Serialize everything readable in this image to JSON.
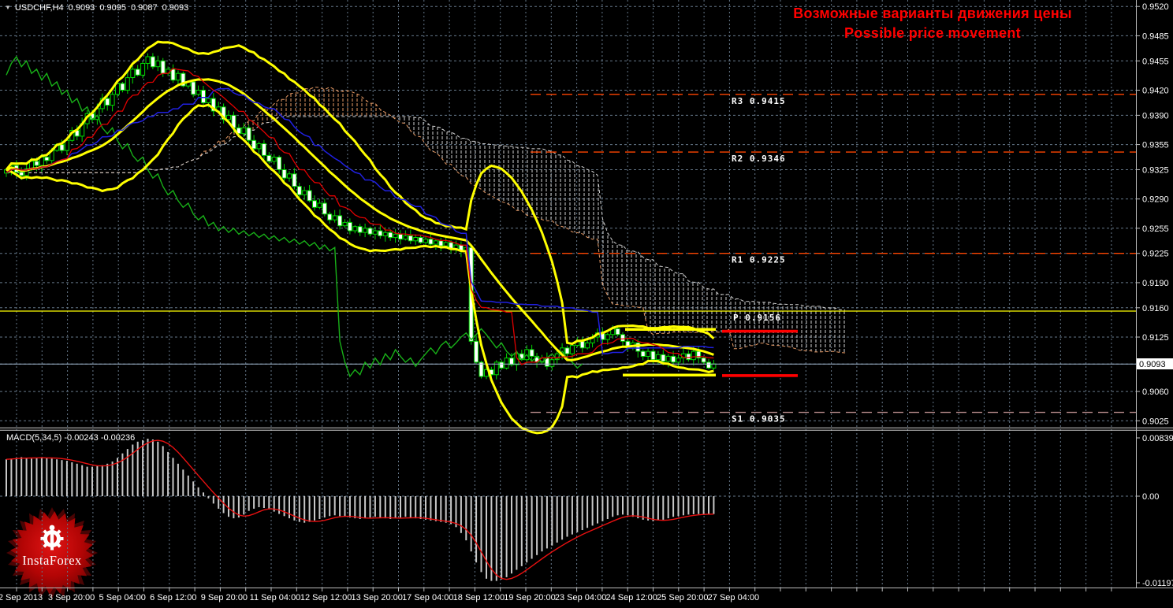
{
  "header": {
    "symbol_period": "USDCHF,H4",
    "open": "0.9093",
    "high": "0.9095",
    "low": "0.9087",
    "close": "0.9093"
  },
  "annotation": {
    "line1": "Возможные варианты движения цены",
    "line2": "Possible price movement",
    "color": "#FF0000"
  },
  "watermark": {
    "brand": "InstaForex"
  },
  "indicator_label": {
    "macd": "MACD(5,34,5) -0.00243 -0.00236"
  },
  "price_axis": {
    "ticks": [
      "0.9520",
      "0.9485",
      "0.9455",
      "0.9420",
      "0.9390",
      "0.9355",
      "0.9325",
      "0.9290",
      "0.9255",
      "0.9225",
      "0.9190",
      "0.9160",
      "0.9125",
      "0.9060",
      "0.9025"
    ],
    "current_price": "0.9093"
  },
  "macd_axis": {
    "ticks": [
      "0.00839",
      "0.00",
      "-0.01197"
    ]
  },
  "time_axis": {
    "labels": [
      "2 Sep 2013",
      "3 Sep 20:00",
      "5 Sep 04:00",
      "6 Sep 12:00",
      "9 Sep 20:00",
      "11 Sep 04:00",
      "12 Sep 12:00",
      "13 Sep 20:00",
      "17 Sep 04:00",
      "18 Sep 12:00",
      "19 Sep 20:00",
      "23 Sep 04:00",
      "24 Sep 12:00",
      "25 Sep 20:00",
      "27 Sep 04:00"
    ]
  },
  "levels": [
    {
      "name": "R3",
      "value": "0.9415",
      "style": "dashed",
      "role": "resistance"
    },
    {
      "name": "R2",
      "value": "0.9346",
      "style": "dashed",
      "role": "resistance"
    },
    {
      "name": "R1",
      "value": "0.9225",
      "style": "dashed",
      "role": "resistance"
    },
    {
      "name": "P",
      "value": "0.9156",
      "style": "solid",
      "role": "pivot"
    },
    {
      "name": "S1",
      "value": "0.9035",
      "style": "dashed",
      "role": "support"
    }
  ],
  "projection_marks": [
    {
      "level": "upper",
      "price": 0.9132
    },
    {
      "level": "lower",
      "price": 0.9079
    }
  ],
  "colors": {
    "background": "#000000",
    "grid": "#66788A",
    "axis_text": "#FFFFFF",
    "border": "#BBBBBB",
    "candle": "#00D800",
    "bear_body": "#FFFFFF",
    "bull_body": "#000000",
    "bollinger": "#FFFF00",
    "tenkan": "#E00000",
    "kijun": "#2020E0",
    "chikou": "#18B018",
    "senkou_a": "#E89B66",
    "senkou_b": "#D4D4D4",
    "resistance": "#FF4500",
    "support": "#BC8F8F",
    "pivot": "#FFFF00",
    "current_price_line": "#9FB6CD",
    "macd_bar": "#C8C8C8",
    "macd_signal": "#E81010",
    "annotation": "#FF0000",
    "projection": "#FF0000"
  },
  "chart_data": [
    {
      "type": "candlestick",
      "title": "USDCHF,H4",
      "x_range": [
        "2 Sep 2013",
        "27 Sep 04:00"
      ],
      "ylim": [
        0.9025,
        0.952
      ],
      "closes": [
        0.9325,
        0.933,
        0.9322,
        0.9318,
        0.9326,
        0.9335,
        0.933,
        0.934,
        0.9336,
        0.9348,
        0.9355,
        0.9348,
        0.936,
        0.9372,
        0.9365,
        0.938,
        0.9392,
        0.9385,
        0.9398,
        0.941,
        0.9402,
        0.9415,
        0.9428,
        0.942,
        0.9435,
        0.9445,
        0.9438,
        0.9452,
        0.946,
        0.9448,
        0.9455,
        0.944,
        0.9445,
        0.9432,
        0.944,
        0.9425,
        0.943,
        0.9415,
        0.942,
        0.9405,
        0.941,
        0.9395,
        0.94,
        0.9385,
        0.939,
        0.9375,
        0.9368,
        0.9375,
        0.936,
        0.935,
        0.9356,
        0.9342,
        0.9335,
        0.934,
        0.9325,
        0.9315,
        0.932,
        0.9305,
        0.9295,
        0.93,
        0.9288,
        0.928,
        0.9285,
        0.9272,
        0.9265,
        0.927,
        0.9258,
        0.9262,
        0.9252,
        0.9257,
        0.925,
        0.9255,
        0.9248,
        0.9252,
        0.9246,
        0.925,
        0.9244,
        0.9248,
        0.9242,
        0.9246,
        0.924,
        0.9244,
        0.9238,
        0.9242,
        0.9236,
        0.924,
        0.9234,
        0.9238,
        0.923,
        0.9235,
        0.9228,
        0.9232,
        0.912,
        0.9095,
        0.9078,
        0.9086,
        0.908,
        0.9095,
        0.9088,
        0.91,
        0.9092,
        0.9105,
        0.9098,
        0.911,
        0.9102,
        0.9095,
        0.91,
        0.909,
        0.9098,
        0.9105,
        0.9112,
        0.9105,
        0.9115,
        0.912,
        0.9112,
        0.9118,
        0.9125,
        0.913,
        0.9122,
        0.9128,
        0.9135,
        0.9128,
        0.912,
        0.9112,
        0.9118,
        0.9108,
        0.9102,
        0.9108,
        0.9098,
        0.9104,
        0.9096,
        0.9102,
        0.9095,
        0.91,
        0.9105,
        0.9098,
        0.9108,
        0.91,
        0.9095,
        0.9088,
        0.9093
      ],
      "indicators": [
        {
          "name": "Bollinger Bands",
          "color": "#FFFF00"
        },
        {
          "name": "Ichimoku Kinko Hyo",
          "tenkan_color": "#E00000",
          "kijun_color": "#2020E0",
          "chikou_color": "#18B018",
          "senkou_a_color": "#E89B66",
          "senkou_b_color": "#D4D4D4"
        }
      ]
    },
    {
      "type": "bar",
      "title": "MACD(5,34,5)",
      "ylim": [
        -0.01197,
        0.00839
      ],
      "current_macd": -0.00243,
      "current_signal": -0.00236,
      "values": [
        0.005,
        0.0051,
        0.0052,
        0.0053,
        0.0052,
        0.0051,
        0.0052,
        0.0053,
        0.0052,
        0.0051,
        0.005,
        0.0049,
        0.0048,
        0.0046,
        0.0044,
        0.0042,
        0.004,
        0.004,
        0.0041,
        0.0042,
        0.0044,
        0.0047,
        0.0052,
        0.0058,
        0.0064,
        0.007,
        0.0074,
        0.0076,
        0.0078,
        0.0077,
        0.0074,
        0.0068,
        0.006,
        0.0052,
        0.0044,
        0.0036,
        0.0028,
        0.002,
        0.0012,
        0.0005,
        -0.0003,
        -0.001,
        -0.0017,
        -0.0023,
        -0.0028,
        -0.003,
        -0.0029,
        -0.0025,
        -0.002,
        -0.0017,
        -0.0015,
        -0.0016,
        -0.0018,
        -0.0021,
        -0.0024,
        -0.0027,
        -0.003,
        -0.0033,
        -0.0035,
        -0.0036,
        -0.0035,
        -0.0033,
        -0.0031,
        -0.0029,
        -0.0027,
        -0.0026,
        -0.0027,
        -0.0028,
        -0.0029,
        -0.003,
        -0.0031,
        -0.003,
        -0.0029,
        -0.0028,
        -0.0029,
        -0.003,
        -0.0031,
        -0.003,
        -0.0029,
        -0.0028,
        -0.0029,
        -0.003,
        -0.0031,
        -0.0032,
        -0.0033,
        -0.0034,
        -0.0035,
        -0.0036,
        -0.0038,
        -0.0042,
        -0.005,
        -0.006,
        -0.0075,
        -0.009,
        -0.0103,
        -0.0112,
        -0.0115,
        -0.0115,
        -0.0113,
        -0.011,
        -0.0105,
        -0.01,
        -0.0095,
        -0.009,
        -0.0085,
        -0.008,
        -0.0075,
        -0.0071,
        -0.0067,
        -0.0063,
        -0.0059,
        -0.0055,
        -0.0052,
        -0.0049,
        -0.0046,
        -0.0043,
        -0.004,
        -0.0037,
        -0.0034,
        -0.0031,
        -0.0028,
        -0.0026,
        -0.0025,
        -0.0026,
        -0.0028,
        -0.003,
        -0.0032,
        -0.0033,
        -0.0034,
        -0.0033,
        -0.0032,
        -0.003,
        -0.0028,
        -0.0027,
        -0.0026,
        -0.0025,
        -0.00245,
        -0.00243,
        -0.00243,
        -0.00243,
        -0.00243
      ]
    }
  ]
}
